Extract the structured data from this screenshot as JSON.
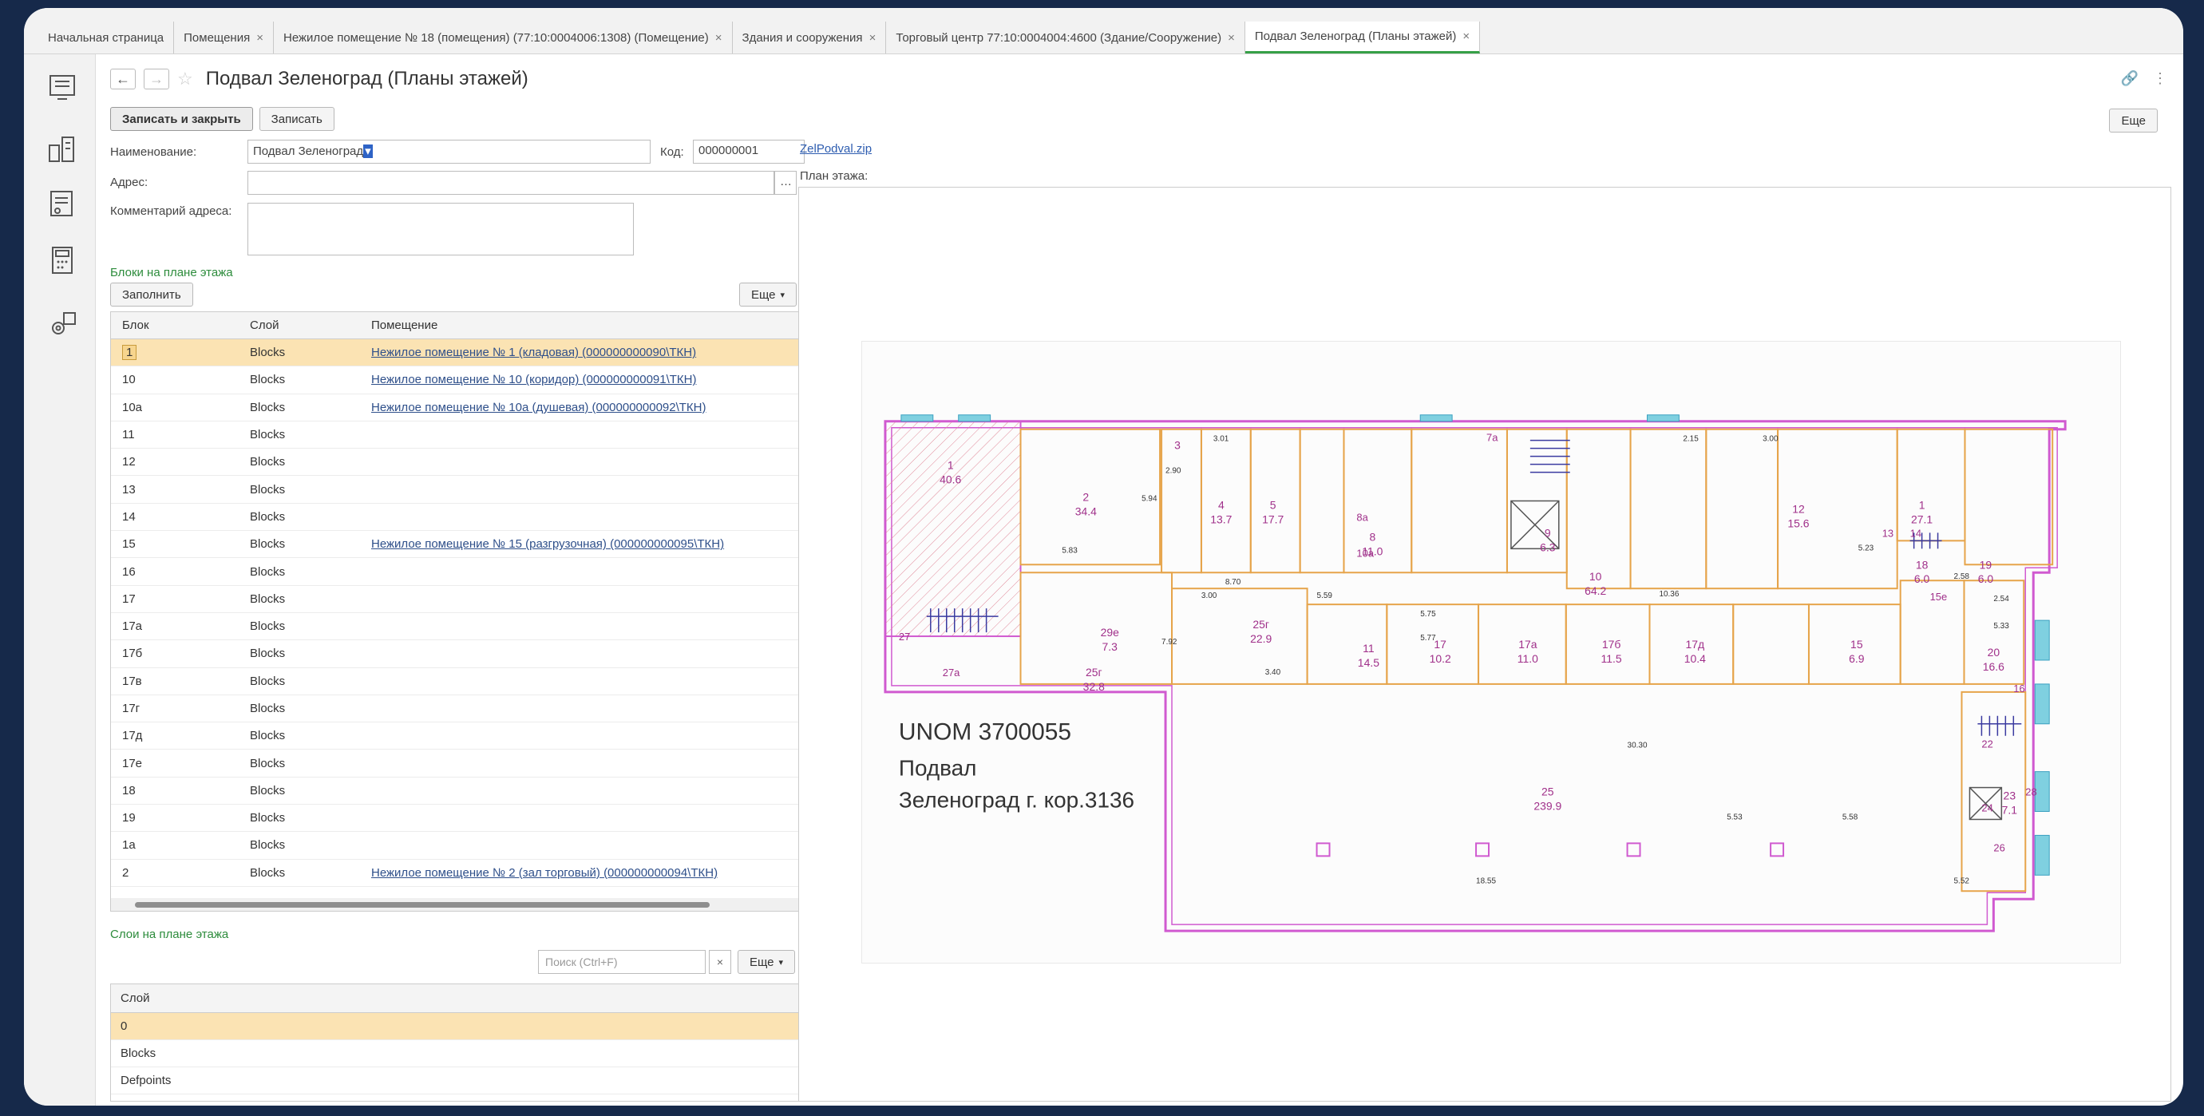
{
  "tabs": [
    {
      "label": "Начальная страница",
      "closable": false
    },
    {
      "label": "Помещения",
      "closable": true
    },
    {
      "label": "Нежилое помещение № 18 (помещения) (77:10:0004006:1308) (Помещение)",
      "closable": true
    },
    {
      "label": "Здания и сооружения",
      "closable": true
    },
    {
      "label": "Торговый центр 77:10:0004004:4600 (Здание/Сооружение)",
      "closable": true
    },
    {
      "label": "Подвал Зеленоград (Планы этажей)",
      "closable": true,
      "active": true
    }
  ],
  "doc": {
    "title": "Подвал Зеленоград (Планы этажей)"
  },
  "toolbar": {
    "save_close": "Записать и закрыть",
    "save": "Записать",
    "more": "Еще"
  },
  "form": {
    "name_label": "Наименование:",
    "name_value": "Подвал Зеленоград",
    "code_label": "Код:",
    "code_value": "000000001",
    "address_label": "Адрес:",
    "address_value": "",
    "address_comment_label": "Комментарий адреса:",
    "address_comment_value": "",
    "file_link": "ZelPodval.zip",
    "plan_label": "План этажа:"
  },
  "blocks": {
    "section_title": "Блоки на плане этажа",
    "fill_button": "Заполнить",
    "more": "Еще",
    "columns": [
      "Блок",
      "Слой",
      "Помещение"
    ],
    "rows": [
      {
        "block": "1",
        "layer": "Blocks",
        "room": "Нежилое помещение № 1 (кладовая) (000000000090\\ТКН)"
      },
      {
        "block": "10",
        "layer": "Blocks",
        "room": "Нежилое помещение № 10 (коридор) (000000000091\\ТКН)"
      },
      {
        "block": "10а",
        "layer": "Blocks",
        "room": "Нежилое помещение № 10а (душевая) (000000000092\\ТКН)"
      },
      {
        "block": "11",
        "layer": "Blocks",
        "room": ""
      },
      {
        "block": "12",
        "layer": "Blocks",
        "room": ""
      },
      {
        "block": "13",
        "layer": "Blocks",
        "room": ""
      },
      {
        "block": "14",
        "layer": "Blocks",
        "room": ""
      },
      {
        "block": "15",
        "layer": "Blocks",
        "room": "Нежилое помещение № 15 (разгрузочная) (000000000095\\ТКН)"
      },
      {
        "block": "16",
        "layer": "Blocks",
        "room": ""
      },
      {
        "block": "17",
        "layer": "Blocks",
        "room": ""
      },
      {
        "block": "17а",
        "layer": "Blocks",
        "room": ""
      },
      {
        "block": "17б",
        "layer": "Blocks",
        "room": ""
      },
      {
        "block": "17в",
        "layer": "Blocks",
        "room": ""
      },
      {
        "block": "17г",
        "layer": "Blocks",
        "room": ""
      },
      {
        "block": "17д",
        "layer": "Blocks",
        "room": ""
      },
      {
        "block": "17е",
        "layer": "Blocks",
        "room": ""
      },
      {
        "block": "18",
        "layer": "Blocks",
        "room": ""
      },
      {
        "block": "19",
        "layer": "Blocks",
        "room": ""
      },
      {
        "block": "1а",
        "layer": "Blocks",
        "room": ""
      },
      {
        "block": "2",
        "layer": "Blocks",
        "room": "Нежилое помещение № 2 (зал торговый) (000000000094\\ТКН)"
      }
    ]
  },
  "layers": {
    "section_title": "Слои на плане этажа",
    "search_placeholder": "Поиск (Ctrl+F)",
    "search_clear": "×",
    "more": "Еще",
    "column": "Слой",
    "rows": [
      "0",
      "Blocks",
      "Defpoints"
    ]
  },
  "plan": {
    "unom": "UNOM 3700055",
    "caption_line1": "Подвал",
    "caption_line2": "Зеленоград г. кор.3136",
    "rooms": [
      {
        "num": "1",
        "area": "40.6"
      },
      {
        "num": "2",
        "area": "34.4"
      },
      {
        "num": "3",
        "area": ""
      },
      {
        "num": "4",
        "area": "13.7"
      },
      {
        "num": "5",
        "area": "17.7"
      },
      {
        "num": "8",
        "area": "11.0"
      },
      {
        "num": "9",
        "area": "6.3"
      },
      {
        "num": "10",
        "area": "64.2"
      },
      {
        "num": "12",
        "area": "15.6"
      },
      {
        "num": "1",
        "area": "27.1"
      },
      {
        "num": "11",
        "area": "14.5"
      },
      {
        "num": "17",
        "area": "10.2"
      },
      {
        "num": "17а",
        "area": "11.0"
      },
      {
        "num": "17б",
        "area": "11.5"
      },
      {
        "num": "17д",
        "area": "10.4"
      },
      {
        "num": "25",
        "area": "239.9"
      },
      {
        "num": "20",
        "area": "16.6"
      },
      {
        "num": "23",
        "area": "7.1"
      },
      {
        "num": "18",
        "area": "6.0"
      },
      {
        "num": "19",
        "area": "6.0"
      },
      {
        "num": "15",
        "area": "6.9"
      },
      {
        "num": "25г",
        "area": "22.9"
      },
      {
        "num": "29е",
        "area": "7.3"
      },
      {
        "num": "25г",
        "area": "32.8"
      }
    ],
    "dims": [
      "3.01",
      "2.90",
      "5.94",
      "5.83",
      "8.70",
      "5.59",
      "3.00",
      "7.92",
      "3.40",
      "5.75",
      "5.77",
      "10.36",
      "30.30",
      "18.55",
      "5.53",
      "5.58",
      "5.52",
      "5.33",
      "5.23",
      "3.00",
      "2.15",
      "2.58",
      "2.54"
    ],
    "extra_labels": [
      "27",
      "27а",
      "13",
      "14",
      "16",
      "22",
      "24",
      "26",
      "28",
      "7а",
      "8а",
      "10а",
      "15е"
    ]
  }
}
